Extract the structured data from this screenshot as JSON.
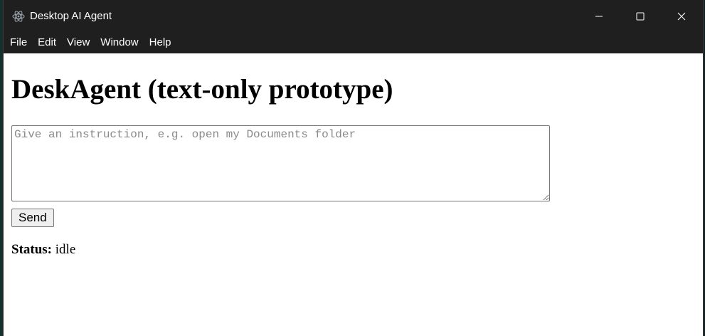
{
  "window": {
    "title": "Desktop AI Agent",
    "icon": "electron-atom-icon",
    "controls": [
      "minimize-icon",
      "maximize-icon",
      "close-icon"
    ]
  },
  "menubar": {
    "items": [
      {
        "label": "File"
      },
      {
        "label": "Edit"
      },
      {
        "label": "View"
      },
      {
        "label": "Window"
      },
      {
        "label": "Help"
      }
    ]
  },
  "main": {
    "heading": "DeskAgent (text-only prototype)",
    "instruction": {
      "value": "",
      "placeholder": "Give an instruction, e.g. open my Documents folder"
    },
    "send_label": "Send",
    "status_label": "Status:",
    "status_value": "idle"
  },
  "colors": {
    "titlebar_bg": "#1f1f1f",
    "titlebar_text": "#ffffff",
    "content_bg": "#ffffff"
  }
}
